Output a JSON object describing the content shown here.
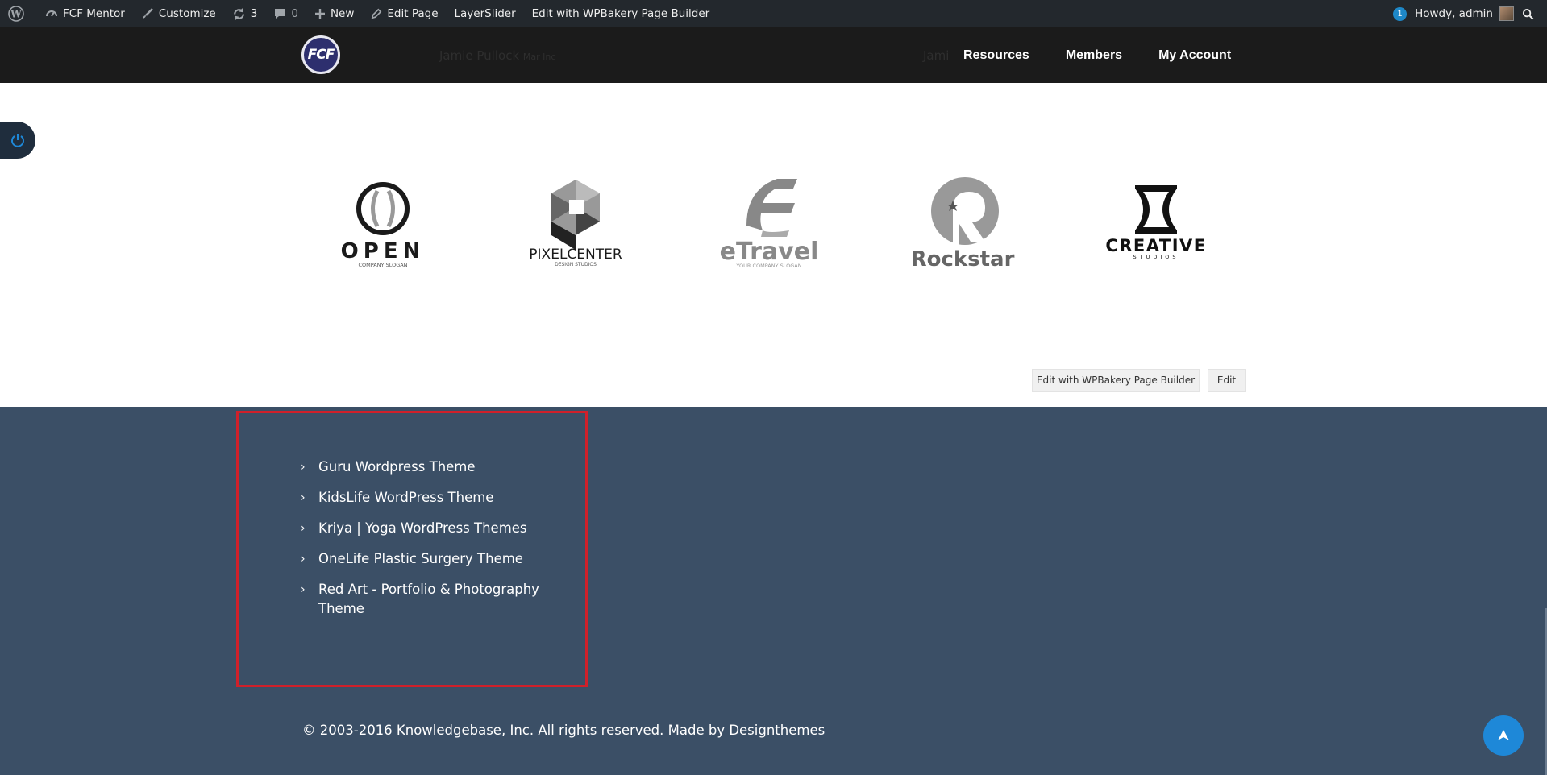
{
  "adminbar": {
    "site_name": "FCF Mentor",
    "customize": "Customize",
    "updates_count": "3",
    "comments_count": "0",
    "new_label": "New",
    "edit_page": "Edit Page",
    "layerslider": "LayerSlider",
    "edit_wpbakery": "Edit with WPBakery Page Builder",
    "notification_count": "1",
    "howdy": "Howdy, admin"
  },
  "header": {
    "logo_text": "FCF",
    "ghost_text_left": "Jamie Pullock",
    "ghost_text_left_small": "Mar Inc",
    "ghost_text_right": "Jami",
    "nav": [
      "Resources",
      "Members",
      "My Account"
    ]
  },
  "logos": [
    {
      "name": "OPEN",
      "tagline": "COMPANY SLOGAN"
    },
    {
      "name": "PIXELCENTER",
      "tagline": "DESIGN STUDIOS"
    },
    {
      "name": "eTravel",
      "tagline": "YOUR COMPANY SLOGAN"
    },
    {
      "name": "Rockstar",
      "tagline": ""
    },
    {
      "name": "CREATIVE",
      "tagline": "STUDIOS"
    }
  ],
  "edit_buttons": {
    "wpbakery": "Edit with WPBakery Page Builder",
    "edit": "Edit"
  },
  "footer": {
    "links": [
      "Guru Wordpress Theme",
      "KidsLife WordPress Theme",
      "Kriya | Yoga WordPress Themes",
      "OneLife Plastic Surgery Theme",
      "Red Art - Portfolio & Photography Theme"
    ],
    "copyright": "© 2003-2016 Knowledgebase, Inc. All rights reserved. Made by Designthemes"
  },
  "colors": {
    "adminbar": "#23282d",
    "header": "#1b1b1b",
    "footer": "#3b4f66",
    "highlight": "#d0202a",
    "accent": "#1e88d8"
  }
}
